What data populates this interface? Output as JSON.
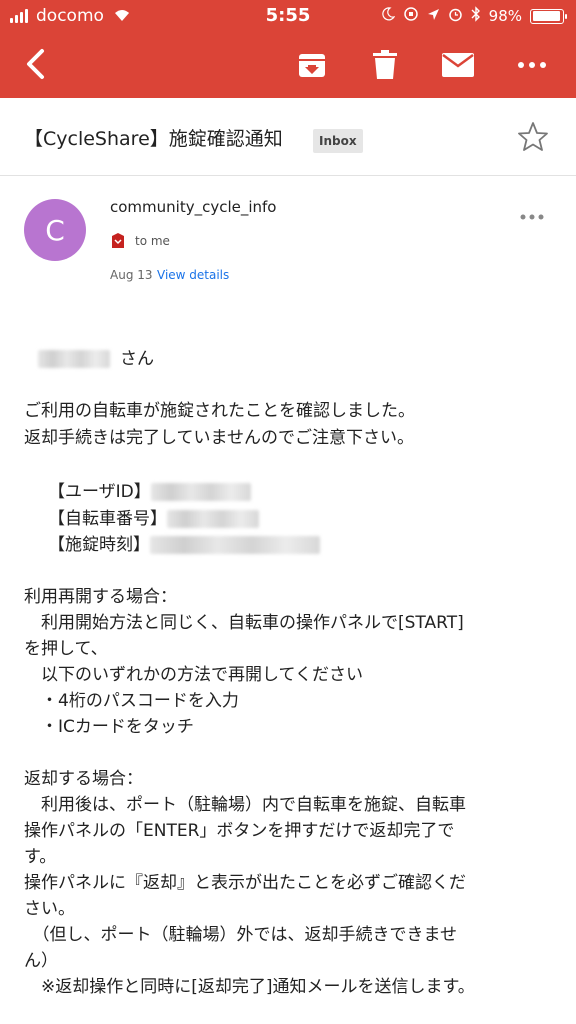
{
  "status_bar": {
    "carrier": "docomo",
    "time": "5:55",
    "battery": "98%",
    "battery_level": 0.98
  },
  "toolbar": {
    "back_icon": "chevron-left-icon",
    "archive_icon": "archive-icon",
    "delete_icon": "trash-icon",
    "mail_icon": "envelope-icon",
    "more_icon": "more-horizontal-icon"
  },
  "subject": {
    "title": "【CycleShare】施錠確認通知",
    "label": "Inbox"
  },
  "sender": {
    "avatar_letter": "C",
    "name": "community_cycle_info",
    "to": "to me",
    "date": "Aug 13",
    "view_details": "View details"
  },
  "body": {
    "greeting_suffix": "さん",
    "intro_1": "ご利用の自転車が施錠されたことを確認しました。",
    "intro_2": "返却手続きは完了していませんのでご注意下さい。",
    "user_id_label": "【ユーザID】",
    "bike_no_label": "【自転車番号】",
    "lock_time_label": "【施錠時刻】",
    "resume_heading": "利用再開する場合：",
    "resume_1": "　利用開始方法と同じく、自転車の操作パネルで[START]",
    "resume_2": "を押して、",
    "resume_3": "　以下のいずれかの方法で再開してください",
    "resume_4": "　・4桁のパスコードを入力",
    "resume_5": "　・ICカードをタッチ",
    "return_heading": "返却する場合：",
    "return_1": "　利用後は、ポート（駐輪場）内で自転車を施錠、自転車",
    "return_2": "操作パネルの「ENTER」ボタンを押すだけで返却完了で",
    "return_3": "す。",
    "return_4": "操作パネルに『返却』と表示が出たことを必ずご確認くだ",
    "return_5": "さい。",
    "return_6": "　（但し、ポート（駐輪場）外では、返却手続きできませ",
    "return_7": "ん）",
    "return_8": "　※返却操作と同時に[返却完了]通知メールを送信します。"
  },
  "colors": {
    "app_bar": "#db4437",
    "avatar": "#b875d0",
    "link": "#1a73e8"
  }
}
